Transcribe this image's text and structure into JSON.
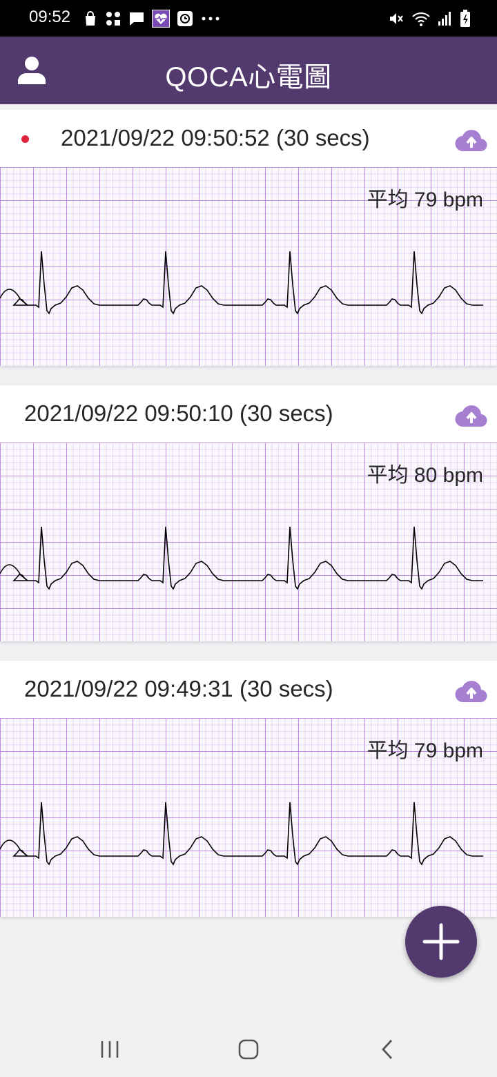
{
  "status_bar": {
    "time": "09:52",
    "left_icons": [
      "shopping-bag-icon",
      "apps-grid-icon",
      "chat-icon",
      "heart-app-icon",
      "clock-app-icon",
      "more-dots-icon"
    ],
    "right_icons": [
      "mute-icon",
      "wifi-icon",
      "signal-icon",
      "battery-icon"
    ]
  },
  "app_bar": {
    "title": "QOCA心電圖",
    "background_color": "#523a6e"
  },
  "records": [
    {
      "timestamp": "2021/09/22 09:50:52 (30 secs)",
      "bpm": "平均 79 bpm",
      "is_new": true
    },
    {
      "timestamp": "2021/09/22 09:50:10 (30 secs)",
      "bpm": "平均 80 bpm",
      "is_new": false
    },
    {
      "timestamp": "2021/09/22 09:49:31 (30 secs)",
      "bpm": "平均 79 bpm",
      "is_new": false
    }
  ],
  "colors": {
    "accent": "#523a6e",
    "upload_icon": "#a77fd1",
    "new_indicator": "#e0243b",
    "grid": "#b684de"
  }
}
